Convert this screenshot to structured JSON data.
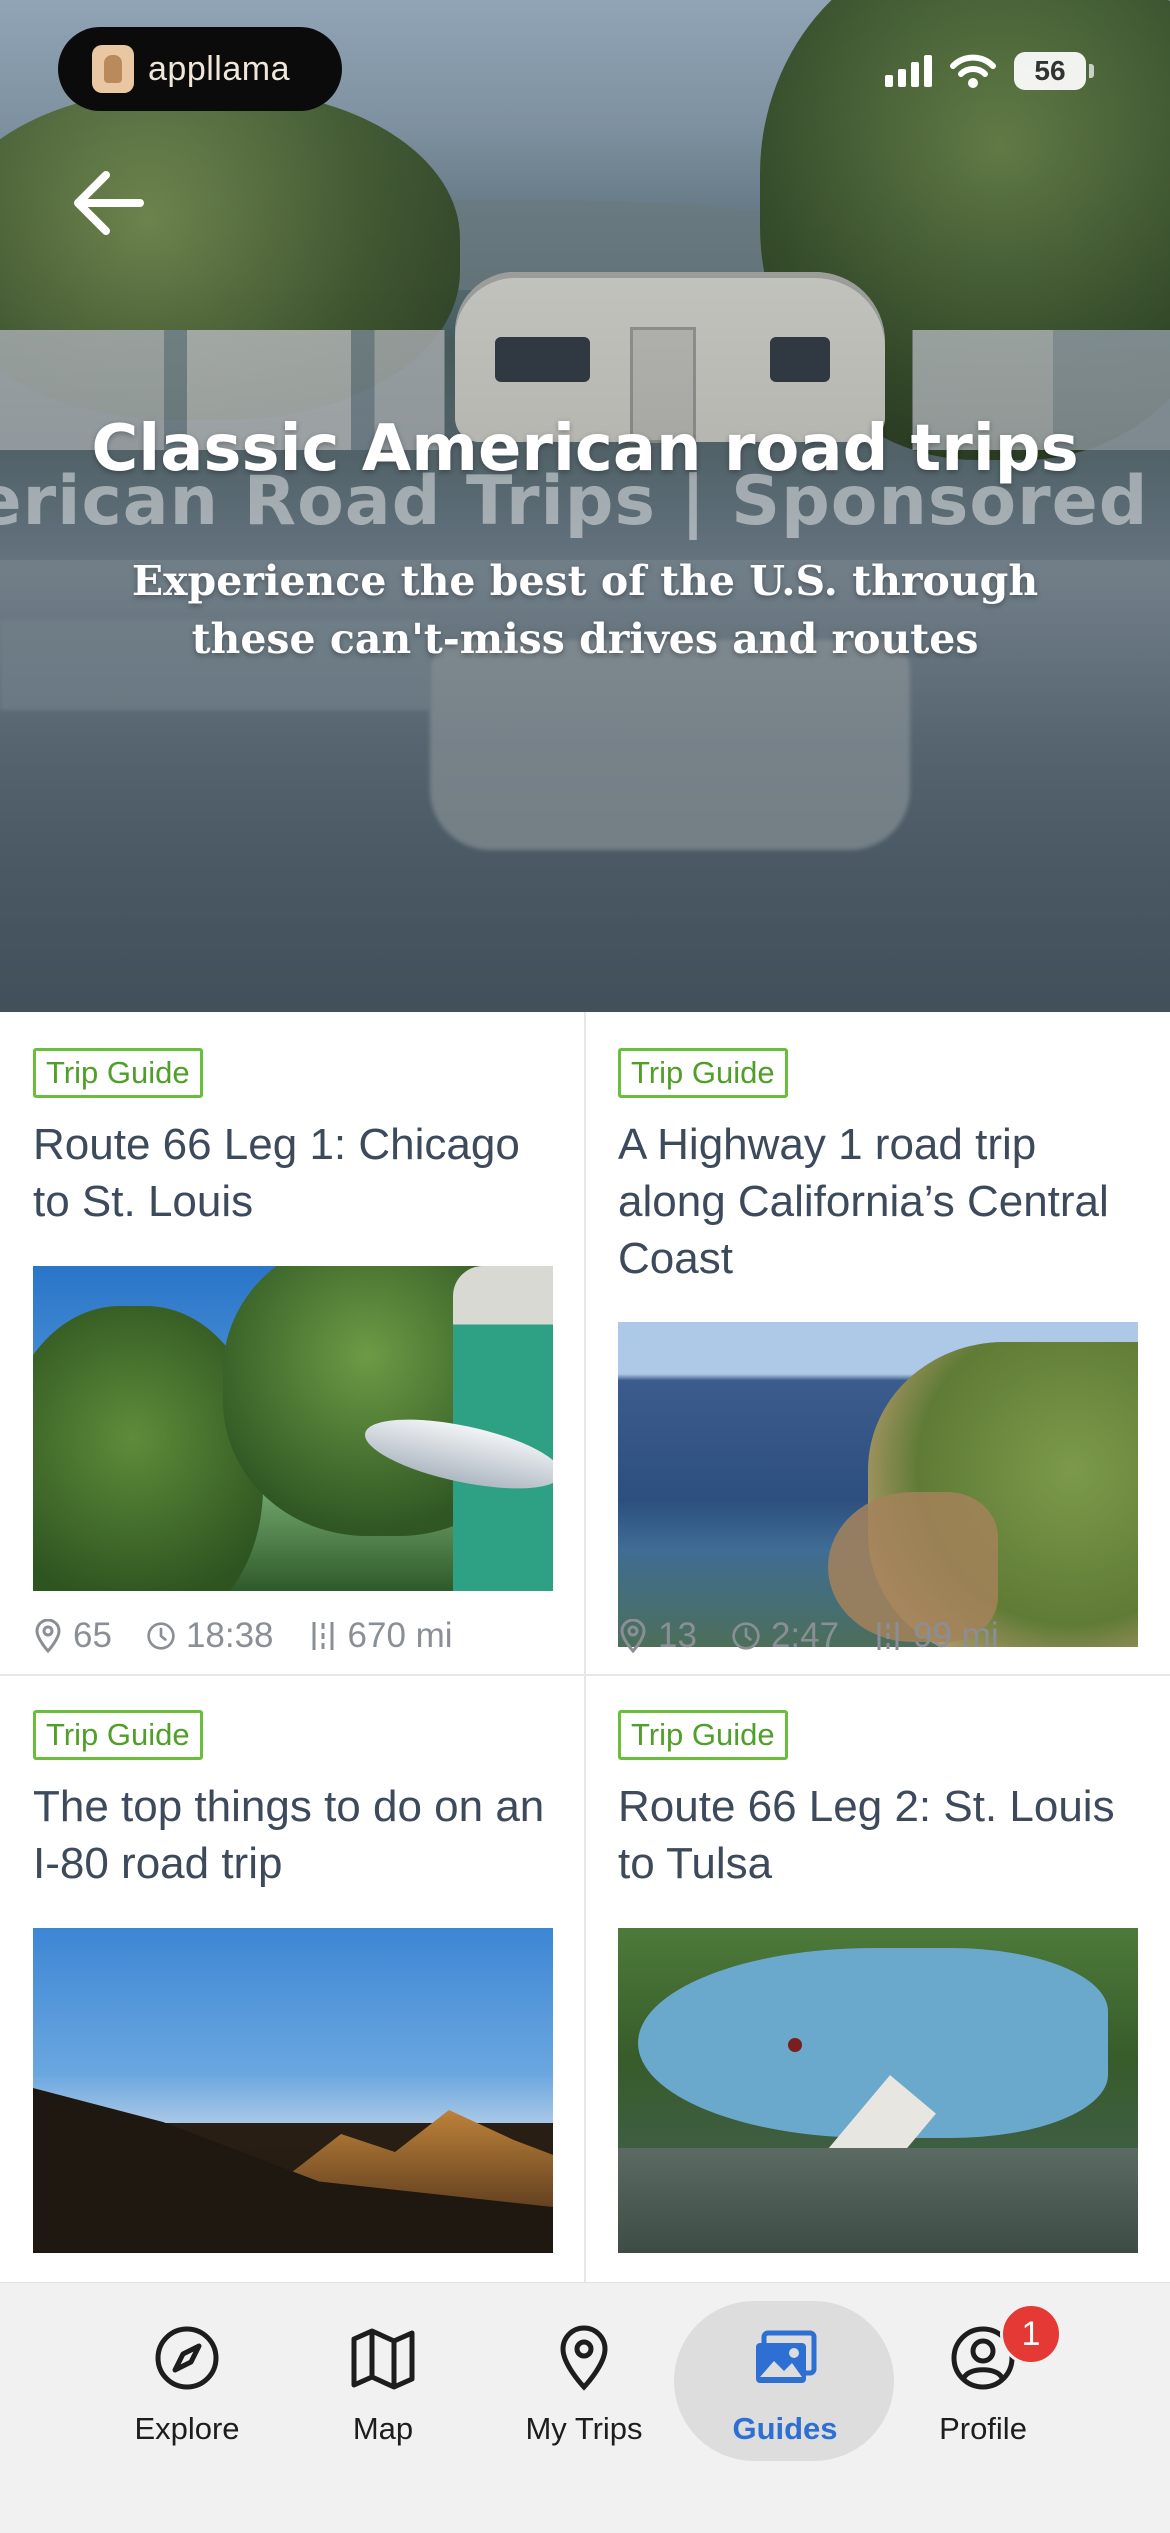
{
  "status_bar": {
    "app_name": "appllama",
    "battery": "56"
  },
  "hero": {
    "watermark": "American Road Trips | Sponsored by P",
    "title": "Classic American road trips",
    "subtitle": "Experience the best of the U.S. through these can't-miss drives and routes"
  },
  "guides": [
    {
      "badge": "Trip Guide",
      "title": "Route 66 Leg 1: Chicago to St. Louis",
      "stops": "65",
      "duration": "18:38",
      "distance": "670 mi"
    },
    {
      "badge": "Trip Guide",
      "title": "A Highway 1 road trip along California’s Central Coast",
      "stops": "13",
      "duration": "2:47",
      "distance": "99 mi"
    },
    {
      "badge": "Trip Guide",
      "title": "The top things to do on an I-80 road trip"
    },
    {
      "badge": "Trip Guide",
      "title": "Route 66 Leg 2: St. Louis to Tulsa"
    }
  ],
  "tabbar": {
    "items": [
      {
        "label": "Explore",
        "icon": "compass-icon"
      },
      {
        "label": "Map",
        "icon": "map-icon"
      },
      {
        "label": "My Trips",
        "icon": "pin-icon"
      },
      {
        "label": "Guides",
        "icon": "photos-icon",
        "active": true
      },
      {
        "label": "Profile",
        "icon": "user-circle-icon"
      }
    ],
    "profile_badge": "1"
  },
  "colors": {
    "accent": "#2d6fd2",
    "badge_green": "#6abf3a",
    "notification": "#e53935"
  }
}
